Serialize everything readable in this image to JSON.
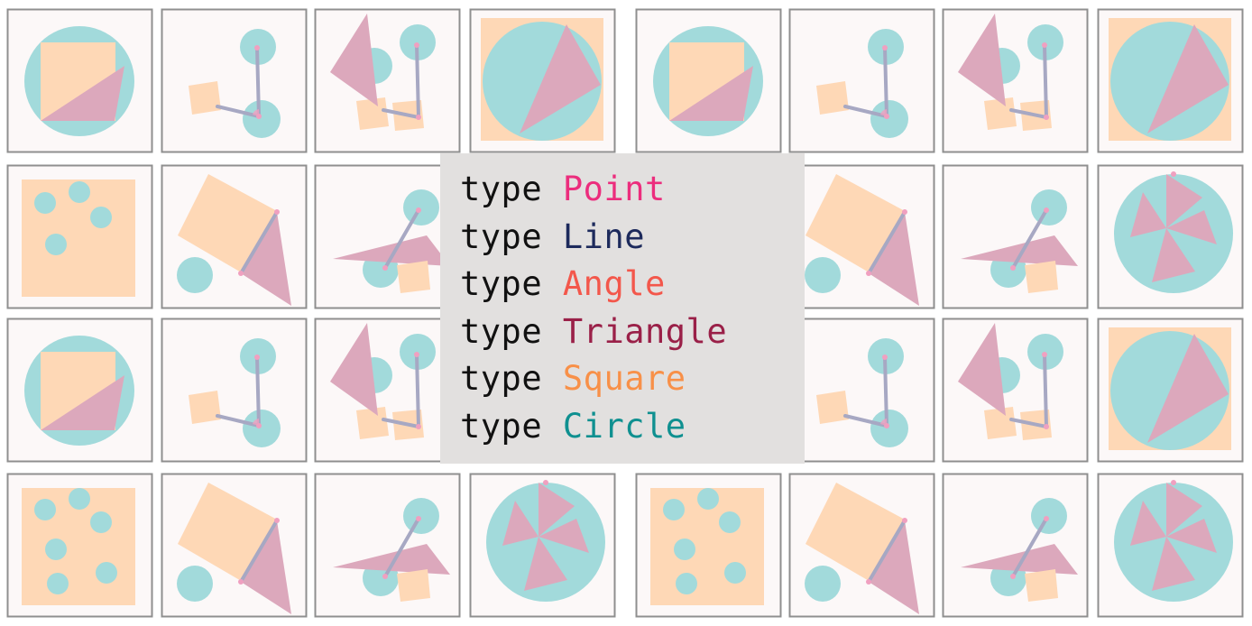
{
  "palette": {
    "circle": "#a2dadb",
    "square": "#fed8b6",
    "triangle": "#dca8bc",
    "line": "#a7a8c3",
    "point": "#f0a0c0",
    "tile_bg": "#fcf8f8",
    "tile_border": "#8f8f8f",
    "panel_bg": "#e2e0df"
  },
  "tiles": [
    {
      "motif": "square-in-circle"
    },
    {
      "motif": "angle-between-circles"
    },
    {
      "motif": "triangle-line-circles"
    },
    {
      "motif": "circle-in-square"
    },
    {
      "motif": "square-in-circle"
    },
    {
      "motif": "angle-between-circles"
    },
    {
      "motif": "triangle-line-circles"
    },
    {
      "motif": "circle-in-square"
    },
    {
      "motif": "circles-on-square-4"
    },
    {
      "motif": "square-line-triangle"
    },
    {
      "motif": "line-triangle-square"
    },
    {
      "motif": "hidden"
    },
    {
      "motif": "hidden"
    },
    {
      "motif": "square-line-triangle"
    },
    {
      "motif": "line-triangle-square"
    },
    {
      "motif": "three-triangles-in-circle"
    },
    {
      "motif": "square-in-circle"
    },
    {
      "motif": "angle-between-circles"
    },
    {
      "motif": "triangle-line-circles"
    },
    {
      "motif": "hidden"
    },
    {
      "motif": "hidden"
    },
    {
      "motif": "angle-between-circles"
    },
    {
      "motif": "triangle-line-circles"
    },
    {
      "motif": "circle-in-square"
    },
    {
      "motif": "circles-on-square-6"
    },
    {
      "motif": "square-line-triangle"
    },
    {
      "motif": "line-triangle-square"
    },
    {
      "motif": "three-triangles-in-circle"
    },
    {
      "motif": "circles-on-square-6"
    },
    {
      "motif": "square-line-triangle"
    },
    {
      "motif": "line-triangle-square"
    },
    {
      "motif": "three-triangles-in-circle"
    }
  ],
  "code": [
    {
      "keyword": "type",
      "name": "Point",
      "color": "#ec2d7d"
    },
    {
      "keyword": "type",
      "name": "Line",
      "color": "#1d2a5c"
    },
    {
      "keyword": "type",
      "name": "Angle",
      "color": "#f3574b"
    },
    {
      "keyword": "type",
      "name": "Triangle",
      "color": "#9a2048"
    },
    {
      "keyword": "type",
      "name": "Square",
      "color": "#f89048"
    },
    {
      "keyword": "type",
      "name": "Circle",
      "color": "#0f9090"
    }
  ]
}
